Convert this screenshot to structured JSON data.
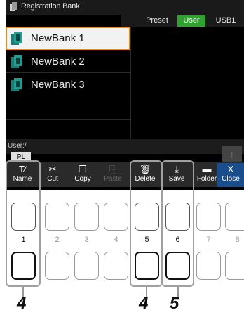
{
  "window": {
    "title": "Registration Bank"
  },
  "tabs": [
    {
      "label": "Preset",
      "active": false
    },
    {
      "label": "User",
      "active": true
    },
    {
      "label": "USB1",
      "active": false
    }
  ],
  "banks": [
    {
      "label": "NewBank 1",
      "selected": true
    },
    {
      "label": "NewBank 2",
      "selected": false
    },
    {
      "label": "NewBank 3",
      "selected": false
    }
  ],
  "path": {
    "text": "User:/",
    "tab": "PL"
  },
  "toolbar": {
    "name": {
      "icon": "rename-icon",
      "label": "Name"
    },
    "cut": {
      "icon": "scissors-icon",
      "label": "Cut"
    },
    "copy": {
      "icon": "copy-icon",
      "label": "Copy"
    },
    "paste": {
      "icon": "paste-icon",
      "label": "Paste"
    },
    "delete": {
      "icon": "trash-icon",
      "label": "Delete"
    },
    "save": {
      "icon": "save-icon",
      "label": "Save"
    },
    "folder": {
      "icon": "folder-icon",
      "label": "Folder"
    },
    "close": {
      "icon": "close-icon",
      "label": "Close"
    }
  },
  "hardware": {
    "numbers": [
      "1",
      "2",
      "3",
      "4",
      "5",
      "6",
      "7",
      "8"
    ]
  },
  "callouts": [
    "4",
    "4",
    "5"
  ],
  "colors": {
    "accent_green": "#2ea12e",
    "select_orange": "#e88a1e",
    "close_blue": "#1a4d8c"
  }
}
